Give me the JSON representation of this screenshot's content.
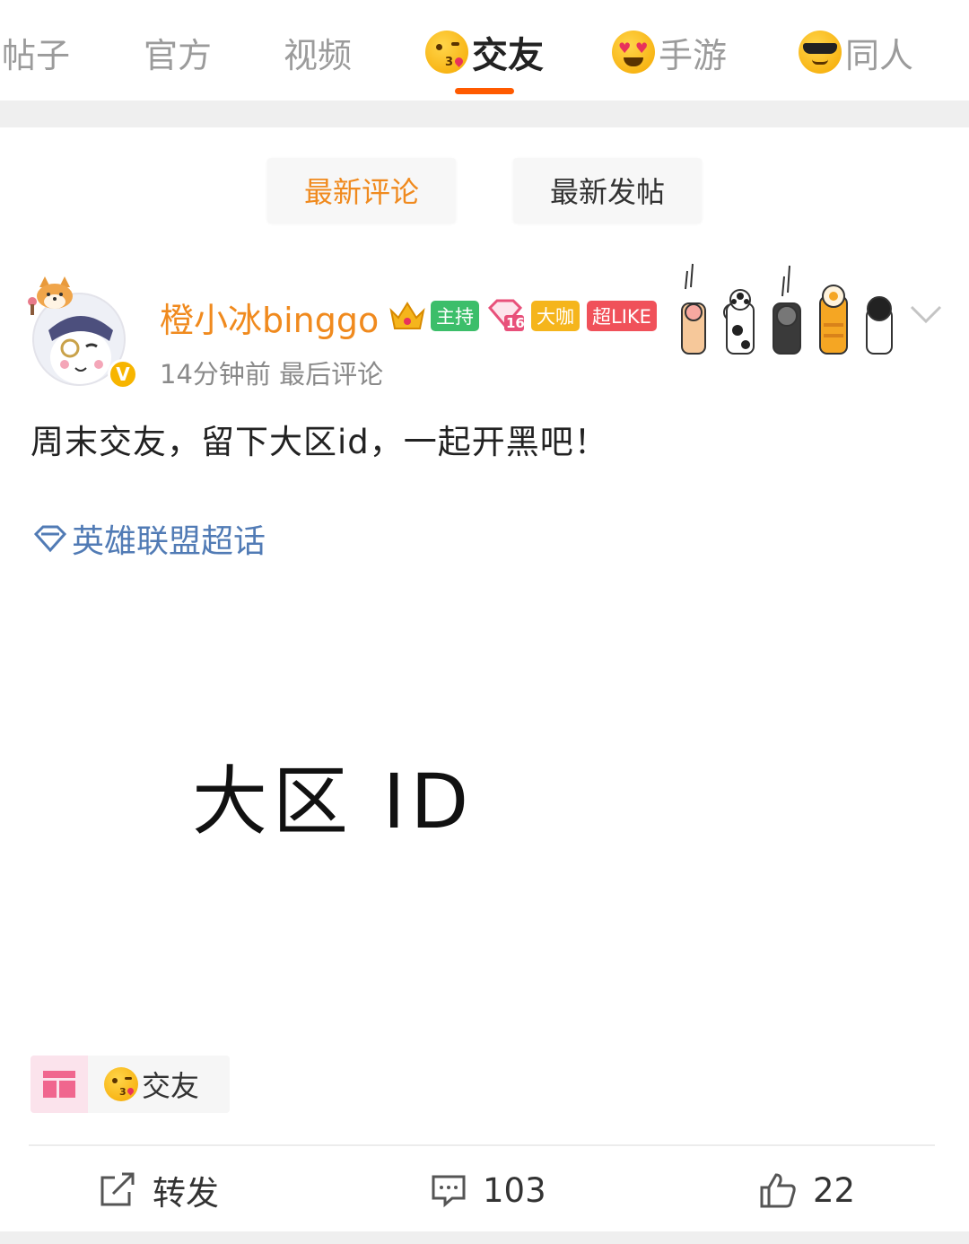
{
  "tabs": [
    {
      "label": "帖子",
      "active": false,
      "emoji": ""
    },
    {
      "label": "官方",
      "active": false,
      "emoji": ""
    },
    {
      "label": "视频",
      "active": false,
      "emoji": ""
    },
    {
      "label": "交友",
      "active": true,
      "emoji": "kissing-face-emoji"
    },
    {
      "label": "手游",
      "active": false,
      "emoji": "heart-eyes-emoji"
    },
    {
      "label": "同人",
      "active": false,
      "emoji": "sunglasses-face-emoji"
    }
  ],
  "sort": {
    "latest_comment": "最新评论",
    "latest_post": "最新发帖",
    "active": "latest_comment"
  },
  "post": {
    "username": "橙小冰binggo",
    "badges": {
      "host": "主持",
      "vip_level": "16",
      "big_shot": "大咖",
      "super_like": "超LIKE"
    },
    "meta": "14分钟前 最后评论",
    "content": "周末交友，留下大区id，一起开黑吧！",
    "topic": "英雄联盟超话",
    "image_text": "大区  ID",
    "tag": "交友"
  },
  "actions": {
    "repost": "转发",
    "comments": "103",
    "likes": "22"
  },
  "colors": {
    "accent_orange": "#f08a1e",
    "tab_underline": "#ff5a00",
    "topic_blue": "#517bb5",
    "badge_green": "#3cbe6a",
    "badge_gold": "#f5b51c",
    "badge_red": "#f0515a"
  }
}
